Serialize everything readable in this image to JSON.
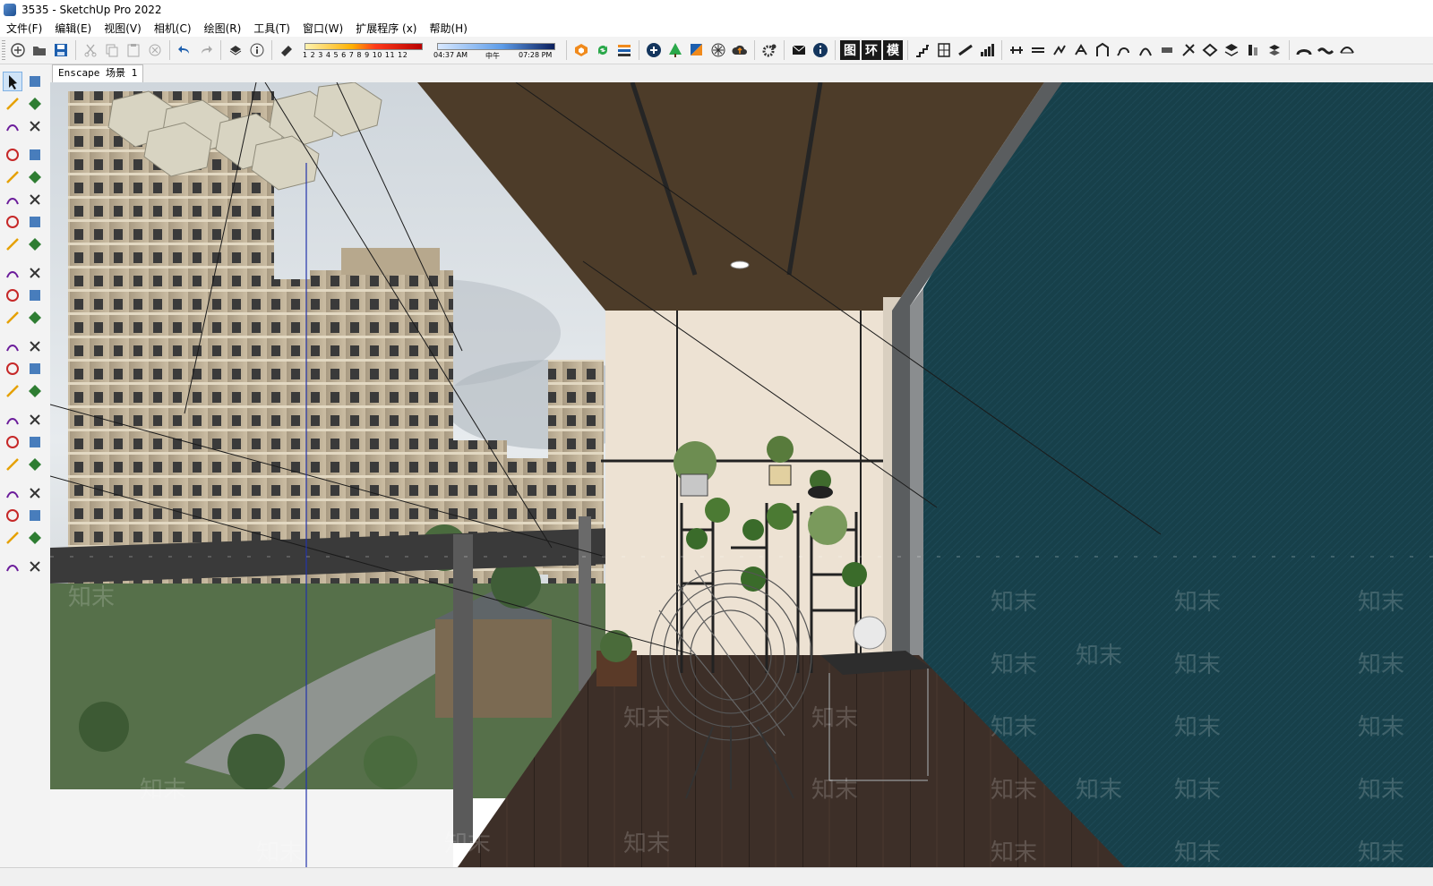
{
  "window": {
    "title": "3535 - SketchUp Pro 2022",
    "app_icon": "sketchup-icon"
  },
  "menu": [
    "文件(F)",
    "编辑(E)",
    "视图(V)",
    "相机(C)",
    "绘图(R)",
    "工具(T)",
    "窗口(W)",
    "扩展程序 (x)",
    "帮助(H)"
  ],
  "toolbar": {
    "shadow_ticks": "1 2 3 4 5 6 7 8 9 10 11 12",
    "time_start": "04:37 AM",
    "time_mid": "中午",
    "time_end": "07:28 PM",
    "box_buttons": [
      "图",
      "环",
      "模"
    ],
    "colors": {
      "accent_orange": "#f08a1c",
      "accent_green": "#2aa84a",
      "accent_blue": "#1d5fae"
    }
  },
  "scene_tab": {
    "label": "Enscape 场景 1"
  },
  "viewport": {
    "watermark_text": "知末",
    "colors": {
      "wall_teal": "#17404a",
      "ceiling": "#4d3c29",
      "floor": "#3d2f28",
      "back_wall": "#ede2d3",
      "railing": "#3a3a3a",
      "sky": "#dfe6ea"
    }
  },
  "left_tools": [
    "select-icon",
    "orbit-icon",
    "paint-bucket-icon",
    "eraser-icon",
    "component-icon",
    "pencil-tag-icon",
    "line-icon",
    "freehand-icon",
    "rectangle-icon",
    "rotated-rectangle-icon",
    "circle-icon",
    "polygon-icon",
    "arc-icon",
    "two-point-arc-icon",
    "three-point-arc-icon",
    "pie-icon",
    "move-icon",
    "push-pull-icon",
    "rotate-icon",
    "follow-me-icon",
    "scale-icon",
    "offset-icon",
    "tape-measure-icon",
    "dimension-icon",
    "protractor-icon",
    "text-icon",
    "axes-icon",
    "3d-text-icon",
    "orbit-view-icon",
    "pan-icon",
    "zoom-icon",
    "zoom-window-icon",
    "zoom-extents-icon",
    "previous-view-icon",
    "position-camera-icon",
    "look-around-icon",
    "walk-icon",
    "section-plane-icon",
    "sandbox-1-icon",
    "sandbox-2-icon",
    "sandbox-3-icon",
    "sandbox-4-icon"
  ]
}
